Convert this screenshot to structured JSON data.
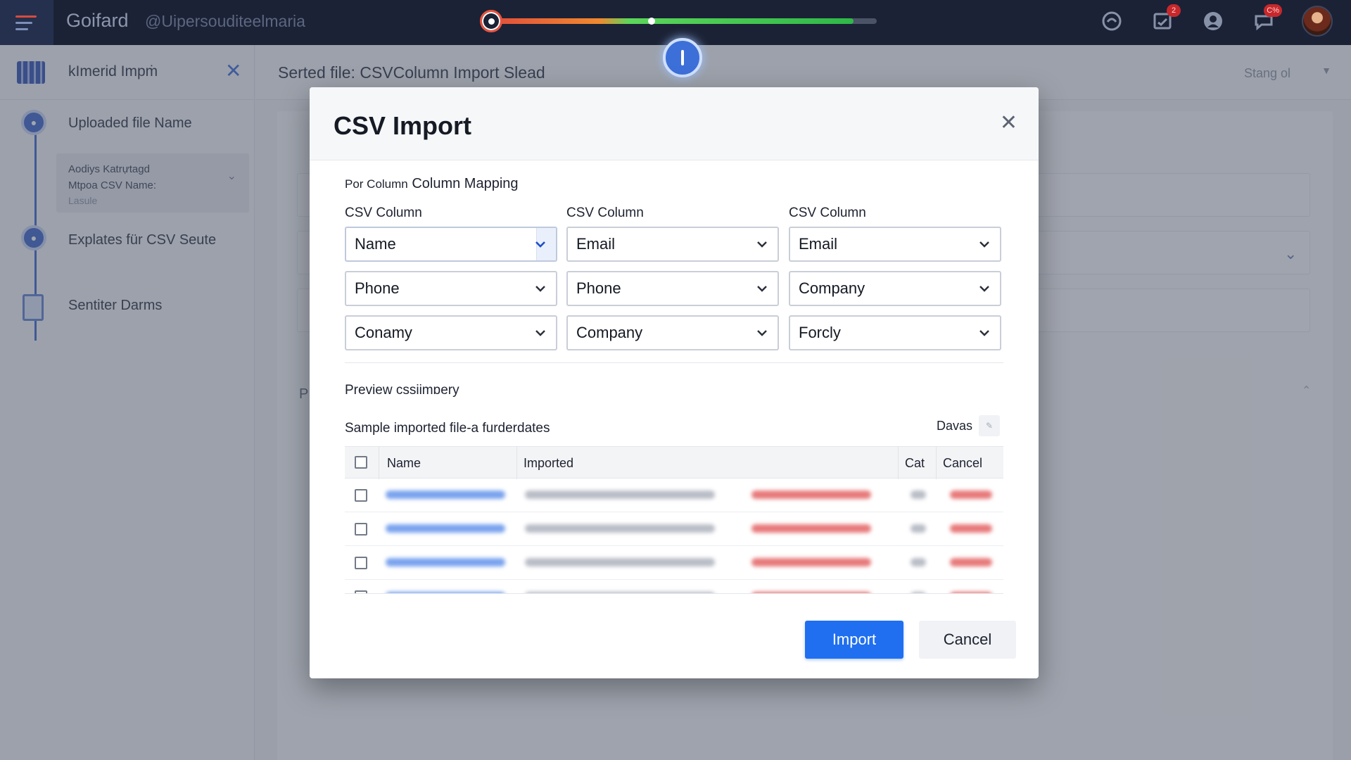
{
  "topbar": {
    "brand": "Goifard",
    "handle": "@Uipersouditeelmaria",
    "progress_percent": 94,
    "notification_badge": "2",
    "alert_badge": "C%"
  },
  "sidebar": {
    "title": "kImerid Impṁ",
    "steps": [
      {
        "label": "Uploaded file Name"
      },
      {
        "label": "Explates für CSV Seute"
      },
      {
        "label": "Sentiter Darms"
      }
    ],
    "sub_item": {
      "line1": "Aodiys Katrựtagd",
      "line2": "Mtpoa CSV Name:",
      "line3": "Lasule"
    }
  },
  "main": {
    "title": "Serted file: CSVColumn Import Slead",
    "status": "Stang ol",
    "bg_letter": "P"
  },
  "modal": {
    "title": "CSV Import",
    "section_prefix": "Por Column",
    "section_title": "Column Mapping",
    "column_labels": [
      "CSV Column",
      "CSV Column",
      "CSV Column"
    ],
    "mapping": [
      [
        "Name",
        "Email",
        "Email"
      ],
      [
        "Phone",
        "Phone",
        "Company"
      ],
      [
        "Conamy",
        "Company",
        "Forcly"
      ]
    ],
    "preview_title": "Preview cssiimɒery",
    "sample_title": "Sample imported file-a furderdates",
    "davas_label": "Davas",
    "table": {
      "headers": [
        "Name",
        "Imported",
        "Cat",
        "Cancel"
      ],
      "row_count": 4
    },
    "import_label": "Import",
    "cancel_label": "Cancel"
  },
  "colors": {
    "topbar": "#1b2236",
    "accent": "#1f6ff0",
    "step": "#3b62c9"
  }
}
